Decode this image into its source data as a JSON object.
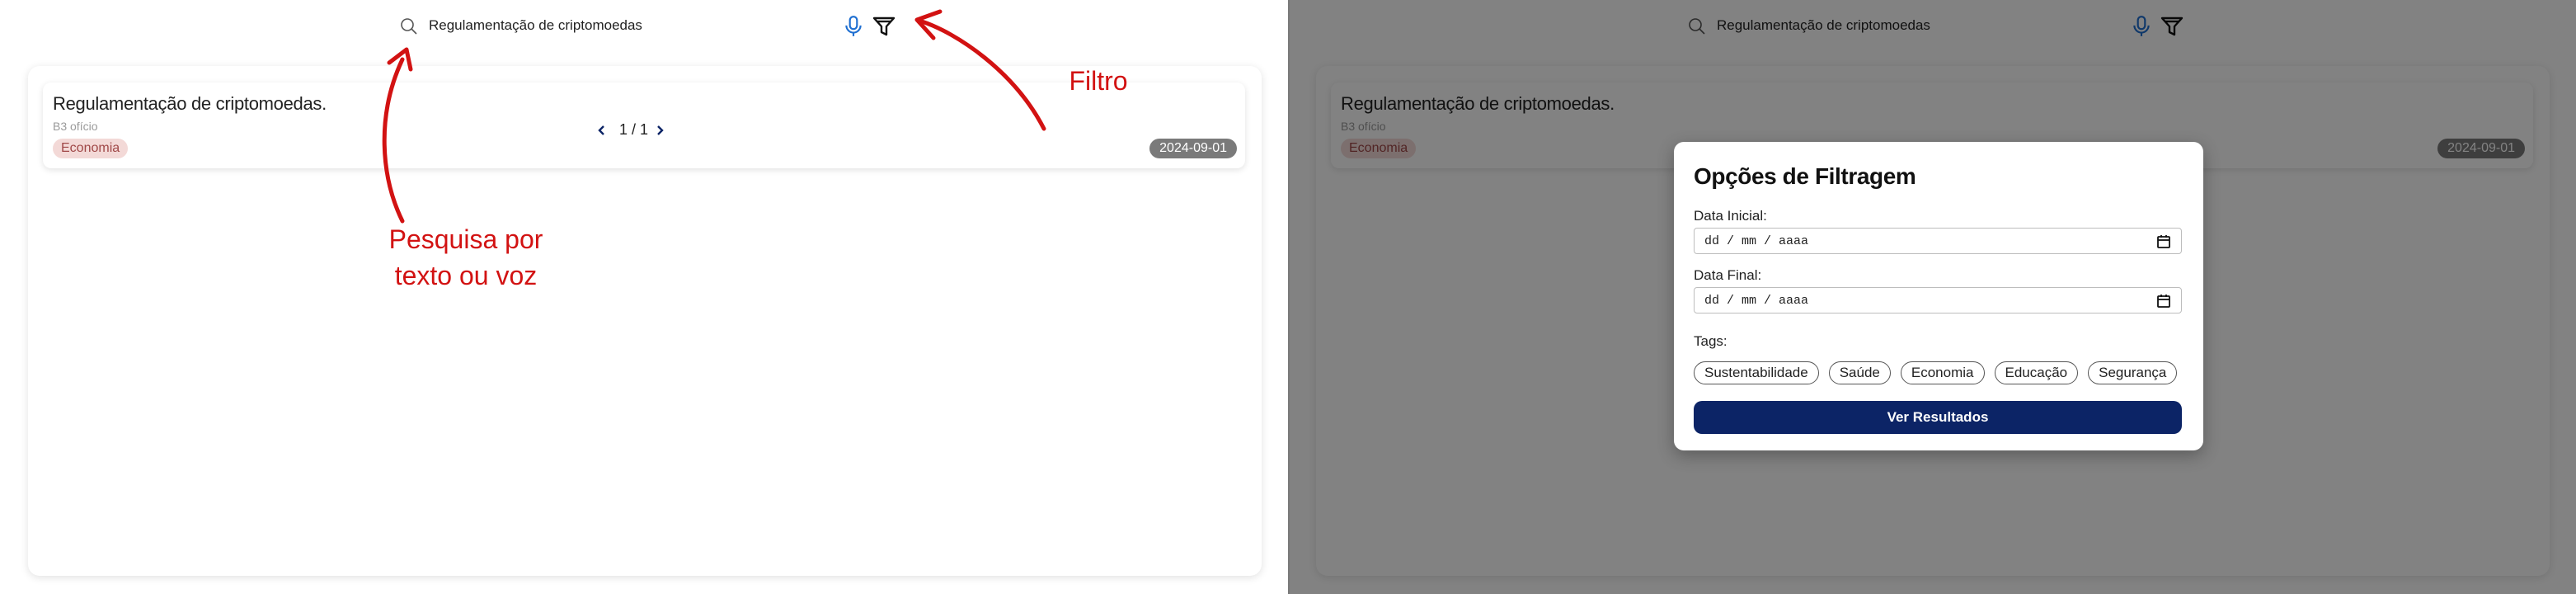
{
  "search": {
    "query": "Regulamentação de criptomoedas",
    "mic_icon": "microphone-icon",
    "filter_icon": "funnel-filter-icon",
    "search_icon": "magnifier-icon"
  },
  "results": [
    {
      "title": "Regulamentação de criptomoedas.",
      "subtitle": "B3 ofício",
      "tag": "Economia",
      "date": "2024-09-01"
    }
  ],
  "pagination": {
    "label": "1 / 1"
  },
  "annotations": {
    "search_hint": "Pesquisa por\ntexto ou voz",
    "filter_hint": "Filtro"
  },
  "filter_modal": {
    "title": "Opções de Filtragem",
    "start_date_label": "Data Inicial:",
    "start_date_placeholder": "dd / mm / aaaa",
    "end_date_label": "Data Final:",
    "end_date_placeholder": "dd / mm / aaaa",
    "tags_label": "Tags:",
    "tags": [
      "Sustentabilidade",
      "Saúde",
      "Economia",
      "Educação",
      "Segurança"
    ],
    "submit_label": "Ver Resultados"
  },
  "colors": {
    "annotation_red": "#d21212",
    "primary_button": "#0c2466",
    "tag_bg": "#f3d9d7",
    "tag_text": "#a04848",
    "date_badge_bg": "#7a7a7a",
    "mic_blue": "#1f6fd1"
  }
}
